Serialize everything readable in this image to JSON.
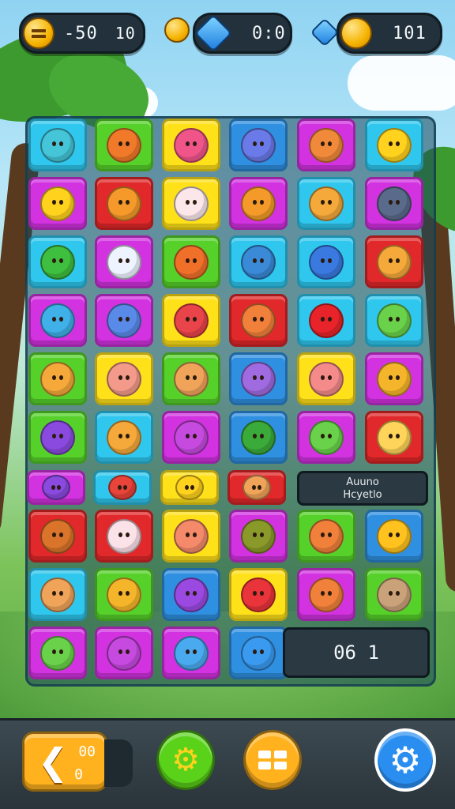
{
  "hud": {
    "left": {
      "icon": "menu-coin-icon",
      "value_a": "-50",
      "value_b": "10"
    },
    "center": {
      "icon": "gem-icon",
      "value": "0:0"
    },
    "right": {
      "icon": "coin-icon",
      "value": "101"
    }
  },
  "board": {
    "colors": {
      "cyan": "#2fc7ee",
      "green": "#56d12a",
      "yellow": "#ffe11a",
      "blue": "#2f8fe0",
      "magenta": "#d232e0",
      "red": "#e1282a"
    },
    "rows": [
      [
        {
          "c": "cyan",
          "icon": "face-icon",
          "f": "#45c5d8"
        },
        {
          "c": "green",
          "icon": "fish-icon",
          "f": "#f07a2a"
        },
        {
          "c": "yellow",
          "icon": "cat-icon",
          "f": "#f0558a"
        },
        {
          "c": "blue",
          "icon": "diamond-icon",
          "f": "#6a7ae8"
        },
        {
          "c": "magenta",
          "icon": "cat-icon",
          "f": "#f08a3a"
        },
        {
          "c": "cyan",
          "icon": "smile-icon",
          "f": "#ffd21e"
        }
      ],
      [
        {
          "c": "magenta",
          "icon": "hammer-icon",
          "f": "#ffd21e"
        },
        {
          "c": "red",
          "icon": "bear-icon",
          "f": "#f59a2a"
        },
        {
          "c": "yellow",
          "icon": "ghost-icon",
          "f": "#fbe7ea"
        },
        {
          "c": "magenta",
          "icon": "swirl-icon",
          "f": "#f39a2a"
        },
        {
          "c": "cyan",
          "icon": "cat-icon",
          "f": "#f5a93a"
        },
        {
          "c": "magenta",
          "icon": "robot-icon",
          "f": "#5a6a8a"
        }
      ],
      [
        {
          "c": "cyan",
          "icon": "leaf-icon",
          "f": "#3fbf3f"
        },
        {
          "c": "magenta",
          "icon": "ghost-icon",
          "f": "#eef4ff"
        },
        {
          "c": "green",
          "icon": "face-icon",
          "f": "#f0702a"
        },
        {
          "c": "cyan",
          "icon": "swirl-icon",
          "f": "#3a8ad8"
        },
        {
          "c": "cyan",
          "icon": "drop-icon",
          "f": "#3a7ae0"
        },
        {
          "c": "red",
          "icon": "cat-icon",
          "f": "#f5a93a"
        }
      ],
      [
        {
          "c": "magenta",
          "icon": "cat-icon",
          "f": "#3fb0e8"
        },
        {
          "c": "magenta",
          "icon": "diamond-icon",
          "f": "#5a8ae8"
        },
        {
          "c": "yellow",
          "icon": "face-icon",
          "f": "#e8444a"
        },
        {
          "c": "red",
          "icon": "cat-icon",
          "f": "#f0803a"
        },
        {
          "c": "cyan",
          "icon": "heart-icon",
          "f": "#e8242a"
        },
        {
          "c": "cyan",
          "icon": "slime-icon",
          "f": "#6ad24a"
        }
      ],
      [
        {
          "c": "green",
          "icon": "cat-icon",
          "f": "#f5a93a"
        },
        {
          "c": "yellow",
          "icon": "cat-icon",
          "f": "#f49a8a"
        },
        {
          "c": "green",
          "icon": "cat-icon",
          "f": "#f0a45a"
        },
        {
          "c": "blue",
          "icon": "swirl-icon",
          "f": "#a06ae0"
        },
        {
          "c": "yellow",
          "icon": "cat-icon",
          "f": "#f48a8a"
        },
        {
          "c": "magenta",
          "icon": "star-icon",
          "f": "#f5b52a"
        }
      ],
      [
        {
          "c": "green",
          "icon": "cat-icon",
          "f": "#8a4ae0"
        },
        {
          "c": "cyan",
          "icon": "cat-icon",
          "f": "#f5a93a"
        },
        {
          "c": "magenta",
          "icon": "face-icon",
          "f": "#c74ae0"
        },
        {
          "c": "blue",
          "icon": "leaf-icon",
          "f": "#3aaa3a"
        },
        {
          "c": "magenta",
          "icon": "slime-icon",
          "f": "#6ad24a"
        },
        {
          "c": "red",
          "icon": "cat-icon",
          "f": "#ffd45a"
        }
      ]
    ],
    "partial_row": [
      {
        "c": "magenta",
        "icon": "cat-icon",
        "f": "#8a4ae0"
      },
      {
        "c": "cyan",
        "icon": "crab-icon",
        "f": "#e8443a"
      },
      {
        "c": "yellow",
        "icon": "smile-icon",
        "f": "#ffd21e"
      },
      {
        "c": "red",
        "icon": "face-icon",
        "f": "#f0a45a"
      }
    ],
    "rows_lower": [
      [
        {
          "c": "red",
          "icon": "swirl-icon",
          "f": "#d9742a"
        },
        {
          "c": "red",
          "icon": "pig-icon",
          "f": "#fbe1e8"
        },
        {
          "c": "yellow",
          "icon": "cat-icon",
          "f": "#f48a6a"
        },
        {
          "c": "magenta",
          "icon": "bug-icon",
          "f": "#8a9a2a"
        },
        {
          "c": "green",
          "icon": "cat-icon",
          "f": "#f0803a"
        },
        {
          "c": "blue",
          "icon": "bird-icon",
          "f": "#ffc21e"
        }
      ],
      [
        {
          "c": "cyan",
          "icon": "cat-icon",
          "f": "#f0a45a"
        },
        {
          "c": "green",
          "icon": "cat-icon",
          "f": "#f5b52a"
        },
        {
          "c": "blue",
          "icon": "swirl-icon",
          "f": "#9a4ae0"
        },
        {
          "c": "yellow",
          "icon": "heart-icon",
          "f": "#e8343a"
        },
        {
          "c": "magenta",
          "icon": "cat-icon",
          "f": "#f0803a"
        },
        {
          "c": "green",
          "icon": "cat-icon",
          "f": "#c9a27a"
        }
      ],
      [
        {
          "c": "magenta",
          "icon": "face-icon",
          "f": "#6ad24a"
        },
        {
          "c": "magenta",
          "icon": "cat-icon",
          "f": "#c74ae0"
        },
        {
          "c": "magenta",
          "icon": "face-icon",
          "f": "#4aaaf0"
        },
        {
          "c": "blue",
          "icon": "face-icon",
          "f": "#3a9af0"
        }
      ]
    ],
    "message": {
      "line1": "Auuno",
      "line2": "Hcyetlo"
    },
    "score": "06 1"
  },
  "bottom": {
    "back_counter_top": "00",
    "back_counter_bottom": "0",
    "buttons": [
      {
        "name": "back-button",
        "icon": "arrow-left-icon",
        "color": "#ffb21e"
      },
      {
        "name": "boost-button",
        "icon": "gear-icon",
        "color": "#5ad21a"
      },
      {
        "name": "menu-button",
        "icon": "grid-icon",
        "color": "#ffb21e"
      },
      {
        "name": "settings-button",
        "icon": "settings-icon",
        "color": "#2a8ef0"
      }
    ]
  }
}
